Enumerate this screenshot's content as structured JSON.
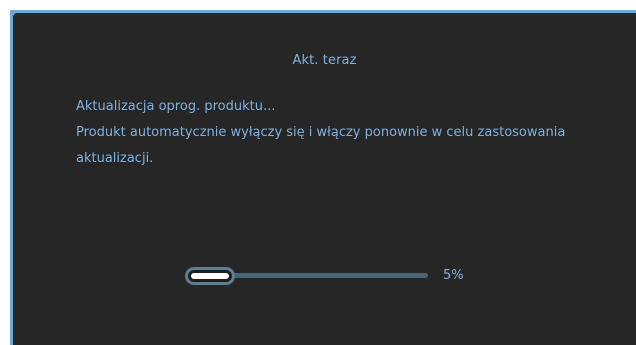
{
  "dialog": {
    "title": "Akt. teraz",
    "lines": [
      "Aktualizacja oprog. produktu...",
      "Produkt automatycznie wyłączy się i włączy ponownie w celu zastosowania",
      "aktualizacji."
    ]
  },
  "progress": {
    "percent_label": "5%",
    "fraction": 0.05
  },
  "colors": {
    "background": "#262626",
    "accent": "#6fa8d6",
    "text": "#7fb2df"
  }
}
